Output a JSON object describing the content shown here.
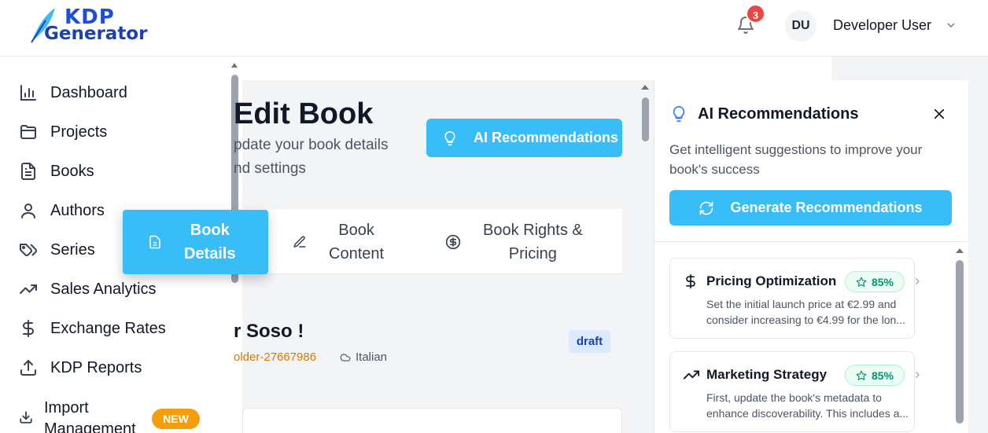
{
  "header": {
    "logo_line1": "KDP",
    "logo_line2": "Generator",
    "notification_count": "3",
    "user_initials": "DU",
    "user_name": "Developer User"
  },
  "sidebar": {
    "items": [
      {
        "label": "Dashboard",
        "icon": "bar-chart-icon"
      },
      {
        "label": "Projects",
        "icon": "folder-icon"
      },
      {
        "label": "Books",
        "icon": "file-text-icon"
      },
      {
        "label": "Authors",
        "icon": "user-icon"
      },
      {
        "label": "Series",
        "icon": "tags-icon"
      },
      {
        "label": "Sales Analytics",
        "icon": "trending-up-icon"
      },
      {
        "label": "Exchange Rates",
        "icon": "dollar-icon"
      },
      {
        "label": "KDP Reports",
        "icon": "upload-icon"
      },
      {
        "label": "Import Management",
        "icon": "download-icon"
      }
    ],
    "import_line1": "Import",
    "import_line2": "Management",
    "new_badge": "NEW"
  },
  "main": {
    "title": "Edit Book",
    "subtitle_line1": "pdate your book details",
    "subtitle_line2": "nd settings",
    "title_visible": "Edit Book",
    "ai_button": "AI Recommendations",
    "tabs": [
      {
        "line1": "Book",
        "line2": "Details",
        "active": true
      },
      {
        "line1": "Book",
        "line2": "Content",
        "active": false
      },
      {
        "line1": "Book Rights &",
        "line2": "Pricing",
        "active": false
      }
    ],
    "book": {
      "title": "r Soso !",
      "folder": "older-27667986",
      "language": "Italian",
      "status": "draft"
    }
  },
  "panel": {
    "title": "AI Recommendations",
    "description": "Get intelligent suggestions to improve your book's success",
    "generate_button": "Generate Recommendations",
    "recommendations": [
      {
        "title": "Pricing Optimization",
        "score": "85%",
        "line1": "Set the initial launch price at €2.99 and",
        "line2": "consider increasing to €4.99 for the lon..."
      },
      {
        "title": "Marketing Strategy",
        "score": "85%",
        "line1": "First, update the book's metadata to",
        "line2": "enhance discoverability. This includes a..."
      }
    ]
  },
  "colors": {
    "accent": "#38bdf8",
    "badge_red": "#ef4444",
    "new_badge": "#f59e0b",
    "score_green": "#059669",
    "folder_orange": "#d97706"
  }
}
